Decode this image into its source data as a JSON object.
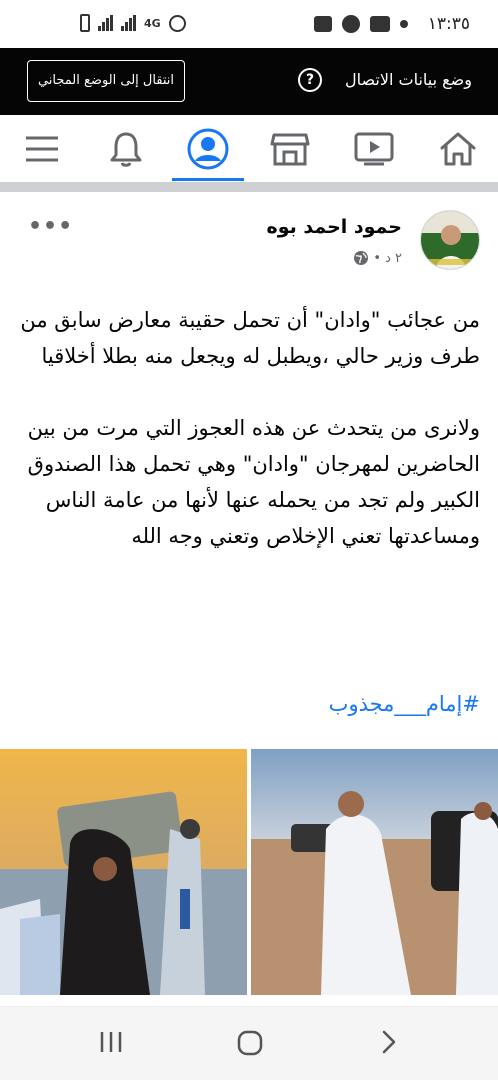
{
  "status_bar": {
    "time": "١٣:٣٥",
    "network": "4G"
  },
  "data_banner": {
    "label": "وضع بيانات الاتصال",
    "free_mode_button": "انتقال إلى الوضع المجاني"
  },
  "nav": {
    "items": [
      "home",
      "watch",
      "marketplace",
      "profile",
      "notifications",
      "menu"
    ],
    "active": "profile",
    "accent": "#1877f2"
  },
  "post": {
    "author": "حمود احمد بوه",
    "time": "٢ د",
    "separator": "•",
    "paragraphs": [
      "من عجائب \"وادان\" أن تحمل حقيبة معارض سابق من طرف وزير حالي ،ويطبل له ويجعل منه بطلا أخلاقيا",
      "ولانرى من يتحدث عن هذه العجوز التي مرت من بين الحاضرين لمهرجان \"وادان\" وهي تحمل هذا الصندوق الكبير ولم تجد من يحمله عنها لأنها من عامة الناس ومساعدتها تعني الإخلاص وتعني وجه الله"
    ],
    "hashtag": "#إمام___مجذوب"
  }
}
